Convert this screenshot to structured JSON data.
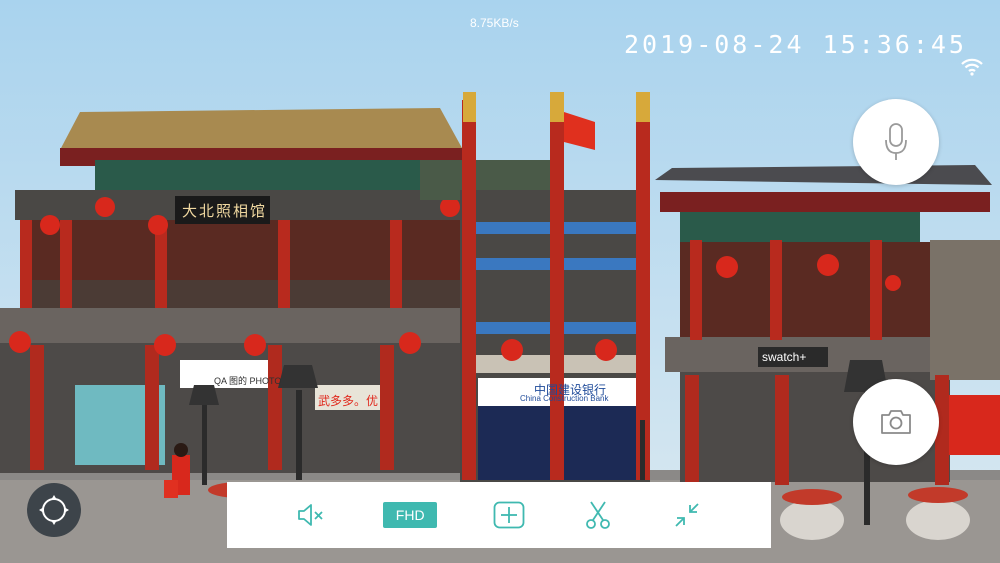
{
  "status": {
    "bitrate": "8.75KB/s",
    "datetime": "2019-08-24 15:36:45"
  },
  "toolbar": {
    "quality_label": "FHD"
  },
  "scene": {
    "shop_sign": "大北照相馆",
    "store_sign_left": "QA 图的 PHOTO",
    "store_sign_red": "武多多。优",
    "bank_sign_cn": "中国建设银行",
    "bank_sign_en": "China Construction Bank",
    "brand_sign": "swatch+"
  },
  "colors": {
    "accent": "#3fb9b0",
    "icon": "#3fb9b0",
    "toolbar_bg": "#ffffff"
  },
  "icons": [
    "wifi-icon",
    "microphone-icon",
    "camera-icon",
    "ptz-direction-icon",
    "mute-icon",
    "expand-view-icon",
    "screenshot-cut-icon",
    "exit-fullscreen-icon"
  ]
}
